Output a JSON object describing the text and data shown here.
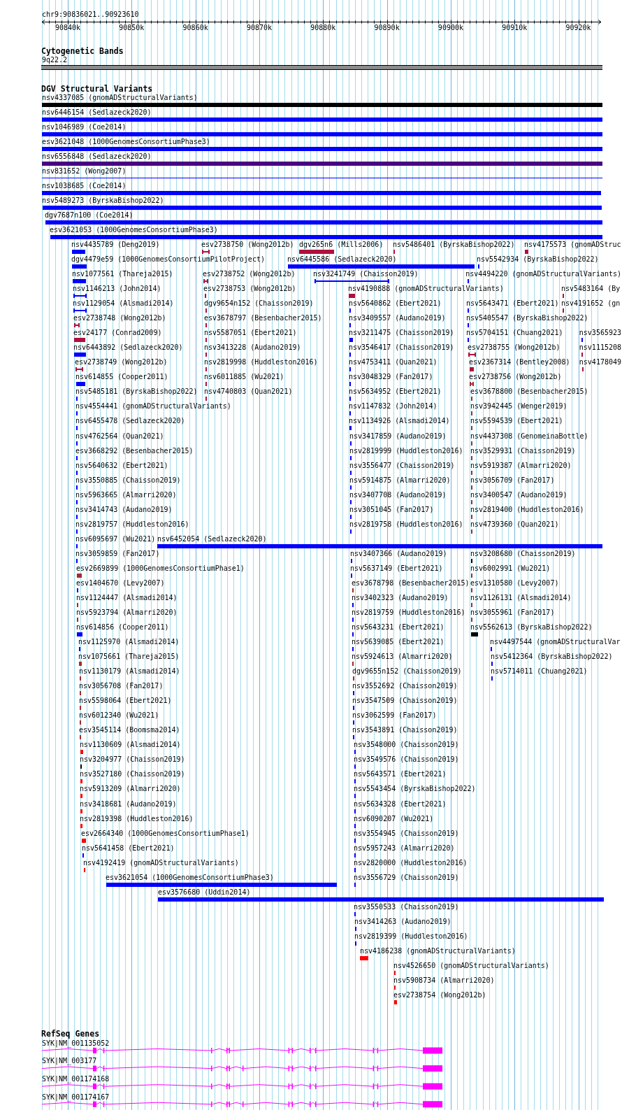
{
  "location": "chr9:90836021..90923610",
  "ruler": {
    "ticks": [
      "90840k",
      "90850k",
      "90860k",
      "90870k",
      "90880k",
      "90890k",
      "90900k",
      "90910k",
      "90920k"
    ]
  },
  "tracks": [
    {
      "kind": "cytoband",
      "title": "Cytogenetic Bands",
      "bands": [
        {
          "label": "9q22.2"
        }
      ]
    },
    {
      "kind": "variants",
      "title": "DGV Structural Variants",
      "features": [
        {
          "label": "nsv4337085 (gnomADStructuralVariants)",
          "kind": "bar",
          "color": "#000000"
        },
        {
          "label": "nsv6446154 (Sedlazeck2020)",
          "kind": "bar",
          "color": "#0000ff"
        },
        {
          "label": "nsv1046989 (Coe2014)",
          "kind": "bar",
          "color": "#0000ff"
        },
        {
          "label": "esv3621048 (1000GenomesConsortiumPhase3)",
          "kind": "bar",
          "color": "#0000ff"
        },
        {
          "label": "nsv6556848 (Sedlazeck2020)",
          "kind": "bar",
          "color": "#4b0082"
        },
        {
          "label": "nsv831652 (Wong2007)",
          "kind": "line",
          "color": "#0000ff"
        },
        {
          "label": "nsv1038685 (Coe2014)",
          "kind": "bar",
          "color": "#0000ff"
        },
        {
          "label": "nsv5489273 (ByrskaBishop2022)",
          "kind": "bar",
          "color": "#0000ff"
        },
        {
          "label": "dgv7687n100 (Coe2014)",
          "kind": "bar",
          "color": "#0000ff"
        },
        {
          "label": "esv3621053 (1000GenomesConsortiumPhase3)",
          "kind": "bar",
          "color": "#0000ff"
        },
        {
          "label": "nsv4435789 (Deng2019)",
          "kind": "bar",
          "color": "#0000ff"
        },
        {
          "label": "esv2738750 (Wong2012b)",
          "kind": "span",
          "color": "#b0103c"
        },
        {
          "label": "dgv265n6 (Mills2006)",
          "kind": "bar",
          "color": "#b0103c"
        },
        {
          "label": "nsv5486401 (ByrskaBishop2022)",
          "kind": "bar",
          "color": "#b0103c"
        },
        {
          "label": "nsv4175573 (gnomADStruc",
          "kind": "bar",
          "color": "#b0103c"
        },
        {
          "label": "dgv4479e59 (1000GenomesConsortiumPilotProject)",
          "kind": "bar",
          "color": "#0000ff"
        },
        {
          "label": "nsv6445586 (Sedlazeck2020)",
          "kind": "bar",
          "color": "#0000ff"
        },
        {
          "label": "nsv5542934 (ByrskaBishop2022)",
          "kind": "bar",
          "color": "#0000ff"
        },
        {
          "label": "nsv1077561 (Thareja2015)",
          "kind": "bar",
          "color": "#0000ff"
        },
        {
          "label": "esv2738752 (Wong2012b)",
          "kind": "span",
          "color": "#b0103c"
        },
        {
          "label": "nsv3241749 (Chaisson2019)",
          "kind": "span",
          "color": "#0000ff"
        },
        {
          "label": "nsv4494220 (gnomADStructuralVariants)",
          "kind": "bar",
          "color": "#0000ff"
        },
        {
          "label": "nsv1146213 (John2014)",
          "kind": "span",
          "color": "#0000ff"
        },
        {
          "label": "esv2738753 (Wong2012b)",
          "kind": "bar",
          "color": "#b0103c"
        },
        {
          "label": "nsv4190888 (gnomADStructuralVariants)",
          "kind": "bar",
          "color": "#b0103c"
        },
        {
          "label": "nsv5483164 (By",
          "kind": "bar",
          "color": "#b0103c"
        },
        {
          "label": "nsv1129054 (Alsmadi2014)",
          "kind": "span",
          "color": "#0000ff"
        },
        {
          "label": "dgv9654n152 (Chaisson2019)",
          "kind": "bar",
          "color": "#b0103c"
        },
        {
          "label": "nsv5640862 (Ebert2021)",
          "kind": "bar",
          "color": "#0000ff"
        },
        {
          "label": "nsv5643471 (Ebert2021)",
          "kind": "bar",
          "color": "#0000ff"
        },
        {
          "label": "nsv4191652 (gn",
          "kind": "bar",
          "color": "#b0103c"
        },
        {
          "label": "esv2738748 (Wong2012b)",
          "kind": "span",
          "color": "#b0103c"
        },
        {
          "label": "esv3678797 (Besenbacher2015)",
          "kind": "bar",
          "color": "#b0103c"
        },
        {
          "label": "nsv3409557 (Audano2019)",
          "kind": "bar",
          "color": "#0000ff"
        },
        {
          "label": "nsv5405547 (ByrskaBishop2022)",
          "kind": "bar",
          "color": "#0000ff"
        },
        {
          "label": "esv24177 (Conrad2009)",
          "kind": "bar",
          "color": "#b0103c"
        },
        {
          "label": "nsv5587051 (Ebert2021)",
          "kind": "bar",
          "color": "#b0103c"
        },
        {
          "label": "nsv3211475 (Chaisson2019)",
          "kind": "bar",
          "color": "#0000ff"
        },
        {
          "label": "nsv5704151 (Chuang2021)",
          "kind": "bar",
          "color": "#0000ff"
        },
        {
          "label": "nsv3565923",
          "kind": "bar",
          "color": "#0000ff"
        },
        {
          "label": "nsv6443892 (Sedlazeck2020)",
          "kind": "bar",
          "color": "#0000ff"
        },
        {
          "label": "nsv3413228 (Audano2019)",
          "kind": "bar",
          "color": "#b0103c"
        },
        {
          "label": "nsv3546417 (Chaisson2019)",
          "kind": "bar",
          "color": "#0000ff"
        },
        {
          "label": "esv2738755 (Wong2012b)",
          "kind": "span",
          "color": "#b0103c"
        },
        {
          "label": "nsv1115208",
          "kind": "bar",
          "color": "#b0103c"
        },
        {
          "label": "esv2738749 (Wong2012b)",
          "kind": "span",
          "color": "#b0103c"
        },
        {
          "label": "nsv2819998 (Huddleston2016)",
          "kind": "bar",
          "color": "#b0103c"
        },
        {
          "label": "nsv4753411 (Quan2021)",
          "kind": "bar",
          "color": "#0000ff"
        },
        {
          "label": "esv2367314 (Bentley2008)",
          "kind": "bar",
          "color": "#b0103c"
        },
        {
          "label": "nsv4178049",
          "kind": "bar",
          "color": "#b0103c"
        },
        {
          "label": "nsv614855 (Cooper2011)",
          "kind": "bar",
          "color": "#0000ff"
        },
        {
          "label": "nsv6011885 (Wu2021)",
          "kind": "bar",
          "color": "#b0103c"
        },
        {
          "label": "nsv3048329 (Fan2017)",
          "kind": "bar",
          "color": "#0000ff"
        },
        {
          "label": "esv2738756 (Wong2012b)",
          "kind": "span",
          "color": "#a52a2a"
        },
        {
          "label": "nsv5485181 (ByrskaBishop2022)",
          "kind": "bar",
          "color": "#0000ff"
        },
        {
          "label": "nsv4740803 (Quan2021)",
          "kind": "bar",
          "color": "#b0103c"
        },
        {
          "label": "nsv5634952 (Ebert2021)",
          "kind": "bar",
          "color": "#0000ff"
        },
        {
          "label": "esv3678800 (Besenbacher2015)",
          "kind": "bar",
          "color": "#a52a2a"
        },
        {
          "label": "nsv4554441 (gnomADStructuralVariants)",
          "kind": "bar",
          "color": "#0000ff"
        },
        {
          "label": "nsv1147832 (John2014)",
          "kind": "bar",
          "color": "#0000ff"
        },
        {
          "label": "nsv3942445 (Wenger2019)",
          "kind": "bar",
          "color": "#a52a2a"
        },
        {
          "label": "nsv6455478 (Sedlazeck2020)",
          "kind": "bar",
          "color": "#0000ff"
        },
        {
          "label": "nsv1134926 (Alsmadi2014)",
          "kind": "bar",
          "color": "#0000ff"
        },
        {
          "label": "nsv5594539 (Ebert2021)",
          "kind": "bar",
          "color": "#a52a2a"
        },
        {
          "label": "nsv4762564 (Quan2021)",
          "kind": "bar",
          "color": "#0000ff"
        },
        {
          "label": "nsv3417859 (Audano2019)",
          "kind": "bar",
          "color": "#0000ff"
        },
        {
          "label": "nsv4437308 (GenomeinaBottle)",
          "kind": "bar",
          "color": "#a52a2a"
        },
        {
          "label": "esv3668292 (Besenbacher2015)",
          "kind": "bar",
          "color": "#0000ff"
        },
        {
          "label": "nsv2819999 (Huddleston2016)",
          "kind": "bar",
          "color": "#0000ff"
        },
        {
          "label": "nsv3529931 (Chaisson2019)",
          "kind": "bar",
          "color": "#a52a2a"
        },
        {
          "label": "nsv5640632 (Ebert2021)",
          "kind": "bar",
          "color": "#0000ff"
        },
        {
          "label": "nsv3556477 (Chaisson2019)",
          "kind": "bar",
          "color": "#0000ff"
        },
        {
          "label": "nsv5919387 (Almarri2020)",
          "kind": "bar",
          "color": "#a52a2a"
        },
        {
          "label": "nsv3550885 (Chaisson2019)",
          "kind": "bar",
          "color": "#0000ff"
        },
        {
          "label": "nsv5914875 (Almarri2020)",
          "kind": "bar",
          "color": "#0000ff"
        },
        {
          "label": "nsv3056709 (Fan2017)",
          "kind": "bar",
          "color": "#a52a2a"
        },
        {
          "label": "nsv5963665 (Almarri2020)",
          "kind": "bar",
          "color": "#0000ff"
        },
        {
          "label": "nsv3407708 (Audano2019)",
          "kind": "bar",
          "color": "#0000ff"
        },
        {
          "label": "nsv3400547 (Audano2019)",
          "kind": "bar",
          "color": "#a52a2a"
        },
        {
          "label": "nsv3414743 (Audano2019)",
          "kind": "bar",
          "color": "#0000ff"
        },
        {
          "label": "nsv3051045 (Fan2017)",
          "kind": "bar",
          "color": "#0000ff"
        },
        {
          "label": "nsv2819400 (Huddleston2016)",
          "kind": "bar",
          "color": "#a52a2a"
        },
        {
          "label": "nsv2819757 (Huddleston2016)",
          "kind": "bar",
          "color": "#0000ff"
        },
        {
          "label": "nsv2819758 (Huddleston2016)",
          "kind": "bar",
          "color": "#0000ff"
        },
        {
          "label": "nsv4739360 (Quan2021)",
          "kind": "bar",
          "color": "#a52a2a"
        },
        {
          "label": "nsv6095697 (Wu2021)",
          "kind": "bar",
          "color": "#0000ff"
        },
        {
          "label": "nsv6452054 (Sedlazeck2020)",
          "kind": "bar",
          "color": "#0000ff"
        },
        {
          "label": "nsv3059859 (Fan2017)",
          "kind": "bar",
          "color": "#0000ff"
        },
        {
          "label": "nsv3407366 (Audano2019)",
          "kind": "bar",
          "color": "#0000ff"
        },
        {
          "label": "nsv3208680 (Chaisson2019)",
          "kind": "bar",
          "color": "#000000"
        },
        {
          "label": "esv2669899 (1000GenomesConsortiumPhase1)",
          "kind": "bar",
          "color": "#a52a2a"
        },
        {
          "label": "nsv5637149 (Ebert2021)",
          "kind": "bar",
          "color": "#0000ff"
        },
        {
          "label": "nsv6002991 (Wu2021)",
          "kind": "bar",
          "color": "#a52a2a"
        },
        {
          "label": "esv1404670 (Levy2007)",
          "kind": "bar",
          "color": "#0000ff"
        },
        {
          "label": "esv3678798 (Besenbacher2015)",
          "kind": "bar",
          "color": "#a52a2a"
        },
        {
          "label": "esv1310580 (Levy2007)",
          "kind": "bar",
          "color": "#a52a2a"
        },
        {
          "label": "nsv1124447 (Alsmadi2014)",
          "kind": "bar",
          "color": "#a52a2a"
        },
        {
          "label": "nsv3402323 (Audano2019)",
          "kind": "bar",
          "color": "#0000ff"
        },
        {
          "label": "nsv1126131 (Alsmadi2014)",
          "kind": "bar",
          "color": "#a52a2a"
        },
        {
          "label": "nsv5923794 (Almarri2020)",
          "kind": "bar",
          "color": "#a52a2a"
        },
        {
          "label": "nsv2819759 (Huddleston2016)",
          "kind": "bar",
          "color": "#0000ff"
        },
        {
          "label": "nsv3055961 (Fan2017)",
          "kind": "bar",
          "color": "#a52a2a"
        },
        {
          "label": "nsv614856 (Cooper2011)",
          "kind": "bar",
          "color": "#0000ff"
        },
        {
          "label": "nsv5643231 (Ebert2021)",
          "kind": "bar",
          "color": "#0000ff"
        },
        {
          "label": "nsv5562613 (ByrskaBishop2022)",
          "kind": "bar",
          "color": "#000000"
        },
        {
          "label": "nsv1125970 (Alsmadi2014)",
          "kind": "bar",
          "color": "#0000ff"
        },
        {
          "label": "nsv5639085 (Ebert2021)",
          "kind": "bar",
          "color": "#0000ff"
        },
        {
          "label": "nsv4497544 (gnomADStructuralVar",
          "kind": "bar",
          "color": "#0000ff"
        },
        {
          "label": "nsv1075661 (Thareja2015)",
          "kind": "bar",
          "color": "#a52a2a"
        },
        {
          "label": "nsv5924613 (Almarri2020)",
          "kind": "bar",
          "color": "#a52a2a"
        },
        {
          "label": "nsv5412364 (ByrskaBishop2022)",
          "kind": "bar",
          "color": "#0000ff"
        },
        {
          "label": "nsv1130179 (Alsmadi2014)",
          "kind": "bar",
          "color": "#a52a2a"
        },
        {
          "label": "dgv9655n152 (Chaisson2019)",
          "kind": "bar",
          "color": "#a52a2a"
        },
        {
          "label": "nsv5714011 (Chuang2021)",
          "kind": "bar",
          "color": "#0000ff"
        },
        {
          "label": "nsv3056708 (Fan2017)",
          "kind": "bar",
          "color": "#a52a2a"
        },
        {
          "label": "nsv3552692 (Chaisson2019)",
          "kind": "bar",
          "color": "#0000ff"
        },
        {
          "label": "nsv5598064 (Ebert2021)",
          "kind": "bar",
          "color": "#a52a2a"
        },
        {
          "label": "nsv3547509 (Chaisson2019)",
          "kind": "bar",
          "color": "#0000ff"
        },
        {
          "label": "nsv6012340 (Wu2021)",
          "kind": "bar",
          "color": "#a52a2a"
        },
        {
          "label": "nsv3062599 (Fan2017)",
          "kind": "bar",
          "color": "#0000ff"
        },
        {
          "label": "esv3545114 (Boomsma2014)",
          "kind": "bar",
          "color": "#a52a2a"
        },
        {
          "label": "nsv3543891 (Chaisson2019)",
          "kind": "bar",
          "color": "#0000ff"
        },
        {
          "label": "nsv1130609 (Alsmadi2014)",
          "kind": "bar",
          "color": "#ff0000"
        },
        {
          "label": "nsv3548000 (Chaisson2019)",
          "kind": "bar",
          "color": "#0000ff"
        },
        {
          "label": "nsv3204977 (Chaisson2019)",
          "kind": "bar",
          "color": "#000000"
        },
        {
          "label": "nsv3549576 (Chaisson2019)",
          "kind": "bar",
          "color": "#0000ff"
        },
        {
          "label": "nsv3527180 (Chaisson2019)",
          "kind": "bar",
          "color": "#ff0000"
        },
        {
          "label": "nsv5643571 (Ebert2021)",
          "kind": "bar",
          "color": "#0000ff"
        },
        {
          "label": "nsv5913209 (Almarri2020)",
          "kind": "bar",
          "color": "#ff0000"
        },
        {
          "label": "nsv5543454 (ByrskaBishop2022)",
          "kind": "bar",
          "color": "#0000ff"
        },
        {
          "label": "nsv3418681 (Audano2019)",
          "kind": "bar",
          "color": "#ff0000"
        },
        {
          "label": "nsv5634328 (Ebert2021)",
          "kind": "bar",
          "color": "#0000ff"
        },
        {
          "label": "nsv2819398 (Huddleston2016)",
          "kind": "bar",
          "color": "#ff0000"
        },
        {
          "label": "nsv6090207 (Wu2021)",
          "kind": "bar",
          "color": "#0000ff"
        },
        {
          "label": "esv2664340 (1000GenomesConsortiumPhase1)",
          "kind": "bar",
          "color": "#ff0000"
        },
        {
          "label": "nsv3554945 (Chaisson2019)",
          "kind": "bar",
          "color": "#0000ff"
        },
        {
          "label": "nsv5641458 (Ebert2021)",
          "kind": "bar",
          "color": "#0000ff"
        },
        {
          "label": "nsv5957243 (Almarri2020)",
          "kind": "bar",
          "color": "#0000ff"
        },
        {
          "label": "nsv4192419 (gnomADStructuralVariants)",
          "kind": "bar",
          "color": "#ff0000"
        },
        {
          "label": "nsv2820000 (Huddleston2016)",
          "kind": "bar",
          "color": "#0000ff"
        },
        {
          "label": "esv3621054 (1000GenomesConsortiumPhase3)",
          "kind": "bar",
          "color": "#0000ff"
        },
        {
          "label": "nsv3556729 (Chaisson2019)",
          "kind": "bar",
          "color": "#0000ff"
        },
        {
          "label": "esv3576680 (Uddin2014)",
          "kind": "bar",
          "color": "#0000ff"
        },
        {
          "label": "nsv3550533 (Chaisson2019)",
          "kind": "bar",
          "color": "#0000ff"
        },
        {
          "label": "nsv3414263 (Audano2019)",
          "kind": "bar",
          "color": "#0000ff"
        },
        {
          "label": "nsv2819399 (Huddleston2016)",
          "kind": "bar",
          "color": "#0000ff"
        },
        {
          "label": "nsv4186238 (gnomADStructuralVariants)",
          "kind": "bar",
          "color": "#ff0000"
        },
        {
          "label": "nsv4526650 (gnomADStructuralVariants)",
          "kind": "bar",
          "color": "#ff0000"
        },
        {
          "label": "nsv5908734 (Almarri2020)",
          "kind": "bar",
          "color": "#ff0000"
        },
        {
          "label": "esv2738754 (Wong2012b)",
          "kind": "bar",
          "color": "#ff0000"
        }
      ]
    },
    {
      "kind": "genes",
      "title": "RefSeq Genes",
      "features": [
        {
          "label": "SYK|NM_001135052"
        },
        {
          "label": "SYK|NM_003177"
        },
        {
          "label": "SYK|NM_001174168"
        },
        {
          "label": "SYK|NM_001174167"
        }
      ]
    }
  ]
}
